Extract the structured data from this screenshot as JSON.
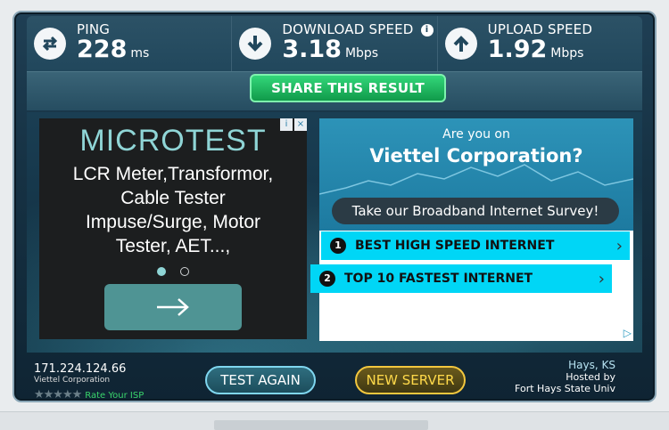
{
  "metrics": {
    "ping": {
      "label": "PING",
      "value": "228",
      "unit": "ms",
      "icon": "sync-arrows-icon"
    },
    "download": {
      "label": "DOWNLOAD SPEED",
      "value": "3.18",
      "unit": "Mbps",
      "info": "i",
      "icon": "download-arrow-icon"
    },
    "upload": {
      "label": "UPLOAD SPEED",
      "value": "1.92",
      "unit": "Mbps",
      "icon": "upload-arrow-icon"
    }
  },
  "share": {
    "label": "SHARE THIS RESULT"
  },
  "ad_left": {
    "brand": "MICROTEST",
    "lines": [
      "LCR Meter,Transformor,",
      "Cable Tester",
      "Impuse/Surge, Motor",
      "Tester, AET...,"
    ],
    "adchoices": [
      "i",
      "×"
    ],
    "colors": {
      "brand": "#8fd5d6",
      "button": "#4f9494"
    }
  },
  "ad_right": {
    "question_small": "Are you on",
    "question_title": "Viettel Corporation?",
    "survey": "Take our Broadband Internet Survey!",
    "items": [
      {
        "num": "1",
        "text": "BEST HIGH SPEED INTERNET"
      },
      {
        "num": "2",
        "text": "TOP 10 FASTEST INTERNET"
      }
    ]
  },
  "isp": {
    "ip": "171.224.124.66",
    "name": "Viettel Corporation",
    "stars": "★★★★★",
    "rate": "Rate Your ISP"
  },
  "buttons": {
    "test_again": "TEST AGAIN",
    "new_server": "NEW SERVER"
  },
  "host": {
    "city": "Hays, KS",
    "hosted_by": "Hosted by",
    "name": "Fort Hays State Univ"
  }
}
